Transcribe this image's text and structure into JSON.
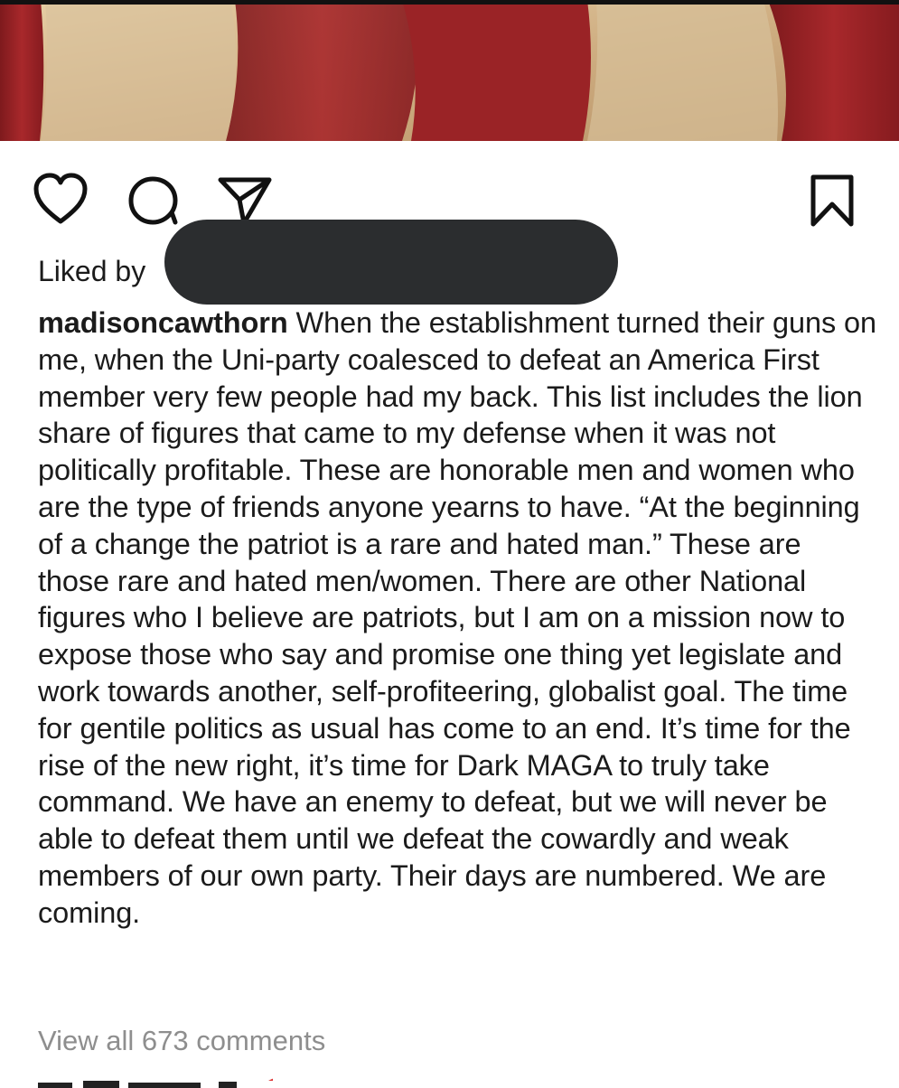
{
  "post": {
    "liked_by_label": "Liked by",
    "username": "madisoncawthorn",
    "caption": "When the establishment turned their guns on me, when the Uni-party coalesced to defeat an America First member very few people had my back. This list includes the lion share of figures that came to my defense when it was not politically profitable. These are honorable men and women who are the type of friends anyone yearns to have. “At the beginning of a change the patriot is a rare and hated man.” These are those rare and hated men/women. There are other National figures who I believe are patriots, but I am on a mission now to expose those who say and promise one thing yet legislate and work towards another, self-profiteering, globalist goal. The time for gentile politics as usual has come to an end. It’s time for the rise of the new right, it’s time for Dark MAGA to truly take command. We have an enemy to defeat, but we will never be able to defeat them until we defeat the cowardly and weak members of our own party. Their days are numbered. We are coming.",
    "view_comments": "View all 673 comments"
  },
  "icons": {
    "like": "heart-icon",
    "comment": "comment-bubble-icon",
    "share": "paper-plane-icon",
    "save": "bookmark-icon"
  },
  "colors": {
    "text": "#1b1b1b",
    "muted": "#8e8e8e",
    "redaction": "#2b2d2f",
    "flag_red": "#9c2226",
    "flag_cream": "#d9bf98"
  }
}
